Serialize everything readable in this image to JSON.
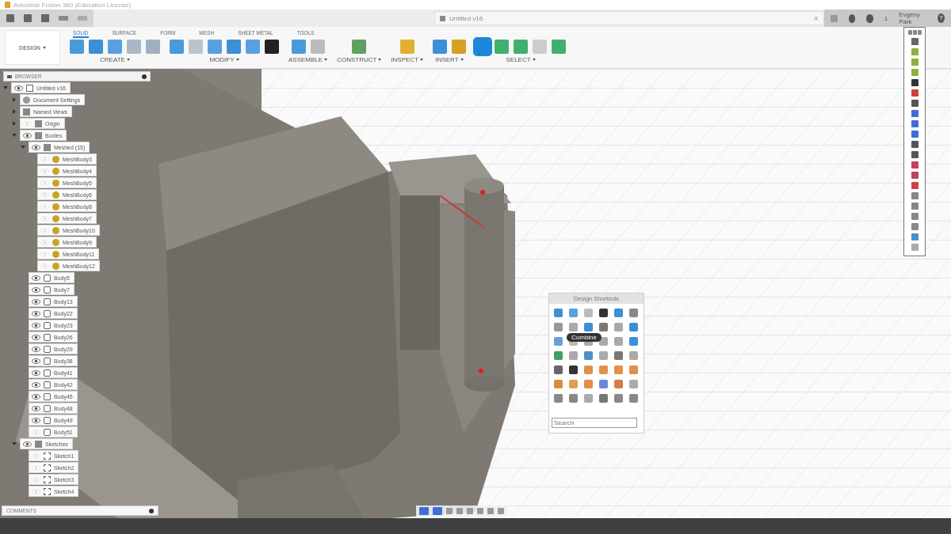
{
  "window": {
    "title": "Autodesk Fusion 360 (Education License)"
  },
  "document_tab": {
    "title": "Untitled v16",
    "close": "×"
  },
  "account": {
    "notifications": "1",
    "user": "Evgeny Park",
    "help": "?"
  },
  "workspace": {
    "label": "DESIGN"
  },
  "ribbon_tabs": [
    {
      "label": "SOLID",
      "selected": true
    },
    {
      "label": "SURFACE",
      "selected": false
    },
    {
      "label": "FORM",
      "selected": false
    },
    {
      "label": "MESH",
      "selected": false
    },
    {
      "label": "SHEET METAL",
      "selected": false
    },
    {
      "label": "TOOLS",
      "selected": false
    }
  ],
  "ribbon_groups": [
    {
      "label": "CREATE"
    },
    {
      "label": "MODIFY"
    },
    {
      "label": "ASSEMBLE"
    },
    {
      "label": "CONSTRUCT"
    },
    {
      "label": "INSPECT"
    },
    {
      "label": "INSERT"
    },
    {
      "label": "SELECT"
    }
  ],
  "browser": {
    "title": "BROWSER",
    "tree": [
      {
        "label": "Untitled v16",
        "kind": "component",
        "visible": true,
        "expanded": true,
        "children": [
          {
            "label": "Document Settings",
            "kind": "settings",
            "expanded": false
          },
          {
            "label": "Named Views",
            "kind": "folder",
            "expanded": false
          },
          {
            "label": "Origin",
            "kind": "folder",
            "visible": false,
            "expanded": false
          },
          {
            "label": "Bodies",
            "kind": "folder",
            "visible": true,
            "expanded": true,
            "children": [
              {
                "label": "Meshed (15)",
                "kind": "folder",
                "visible": true,
                "expanded": true,
                "children": [
                  {
                    "label": "MeshBody3",
                    "kind": "mesh",
                    "visible": false
                  },
                  {
                    "label": "MeshBody4",
                    "kind": "mesh",
                    "visible": false
                  },
                  {
                    "label": "MeshBody5",
                    "kind": "mesh",
                    "visible": false
                  },
                  {
                    "label": "MeshBody6",
                    "kind": "mesh",
                    "visible": false
                  },
                  {
                    "label": "MeshBody8",
                    "kind": "mesh",
                    "visible": false
                  },
                  {
                    "label": "MeshBody7",
                    "kind": "mesh",
                    "visible": false
                  },
                  {
                    "label": "MeshBody10",
                    "kind": "mesh",
                    "visible": false
                  },
                  {
                    "label": "MeshBody9",
                    "kind": "mesh",
                    "visible": false
                  },
                  {
                    "label": "MeshBody11",
                    "kind": "mesh",
                    "visible": false
                  },
                  {
                    "label": "MeshBody12",
                    "kind": "mesh",
                    "visible": false
                  }
                ]
              },
              {
                "label": "Body5",
                "kind": "body",
                "visible": true
              },
              {
                "label": "Body7",
                "kind": "body",
                "visible": true
              },
              {
                "label": "Body13",
                "kind": "body",
                "visible": true
              },
              {
                "label": "Body22",
                "kind": "body",
                "visible": true
              },
              {
                "label": "Body23",
                "kind": "body",
                "visible": true
              },
              {
                "label": "Body26",
                "kind": "body",
                "visible": true
              },
              {
                "label": "Body29",
                "kind": "body",
                "visible": true
              },
              {
                "label": "Body38",
                "kind": "body",
                "visible": true
              },
              {
                "label": "Body41",
                "kind": "body",
                "visible": true
              },
              {
                "label": "Body42",
                "kind": "body",
                "visible": true
              },
              {
                "label": "Body45",
                "kind": "body",
                "visible": true
              },
              {
                "label": "Body48",
                "kind": "body",
                "visible": true
              },
              {
                "label": "Body49",
                "kind": "body",
                "visible": true
              },
              {
                "label": "Body51",
                "kind": "body",
                "visible": false
              }
            ]
          },
          {
            "label": "Sketches",
            "kind": "folder",
            "visible": true,
            "expanded": true,
            "children": [
              {
                "label": "Sketch1",
                "kind": "sketch",
                "visible": false
              },
              {
                "label": "Sketch2",
                "kind": "sketch",
                "visible": false
              },
              {
                "label": "Sketch3",
                "kind": "sketch",
                "visible": false
              },
              {
                "label": "Sketch4",
                "kind": "sketch",
                "visible": false
              }
            ]
          }
        ]
      }
    ]
  },
  "comments": {
    "label": "COMMENTS"
  },
  "design_shortcuts": {
    "title": "Design Shortcuts",
    "tooltip": "Combine",
    "search": {
      "placeholder": "Search"
    }
  }
}
